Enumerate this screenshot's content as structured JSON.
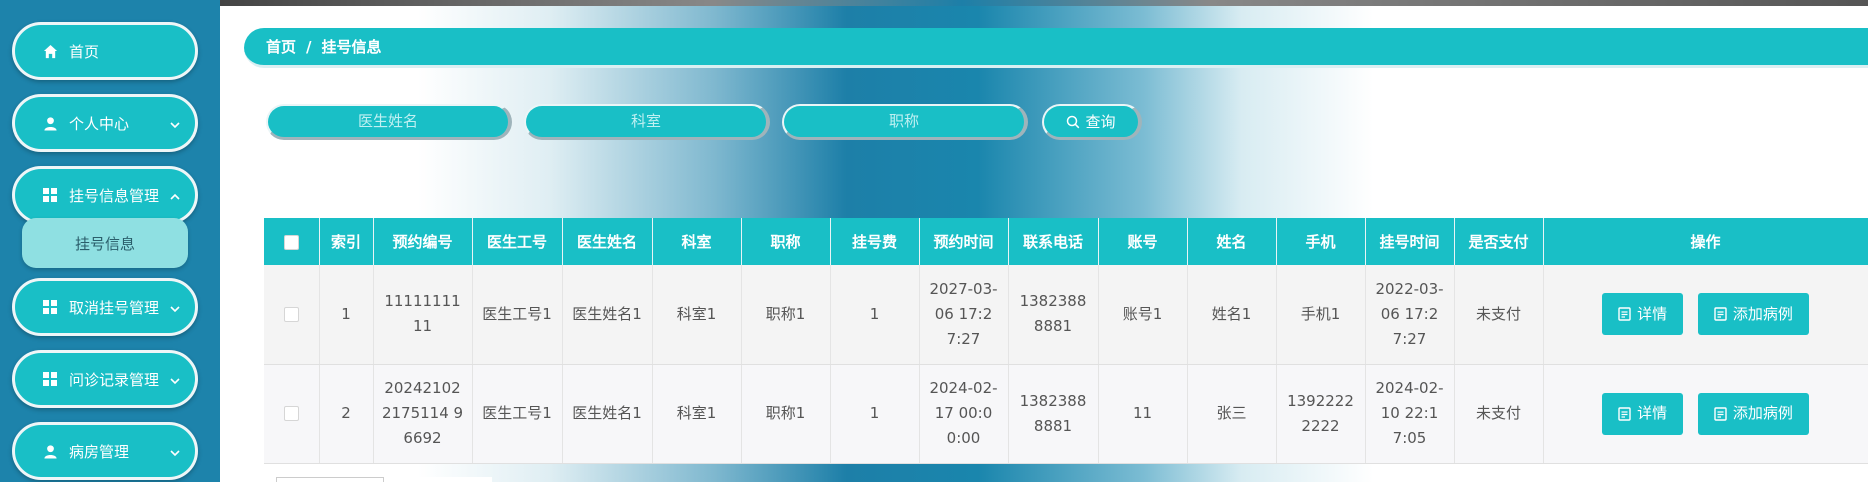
{
  "sidebar": {
    "items": [
      {
        "label": "首页",
        "icon": "home-icon"
      },
      {
        "label": "个人中心",
        "icon": "user-icon"
      },
      {
        "label": "挂号信息管理",
        "icon": "grid-icon"
      },
      {
        "label": "取消挂号管理",
        "icon": "grid-icon"
      },
      {
        "label": "问诊记录管理",
        "icon": "grid-icon"
      },
      {
        "label": "病房管理",
        "icon": "user-icon"
      }
    ],
    "submenu": {
      "label": "挂号信息"
    }
  },
  "breadcrumb": {
    "home": "首页",
    "separator": "/",
    "current": "挂号信息"
  },
  "search": {
    "doctor_name_placeholder": "医生姓名",
    "department_placeholder": "科室",
    "title_placeholder": "职称",
    "query_label": "查询"
  },
  "table": {
    "columns": [
      "索引",
      "预约编号",
      "医生工号",
      "医生姓名",
      "科室",
      "职称",
      "挂号费",
      "预约时间",
      "联系电话",
      "账号",
      "姓名",
      "手机",
      "挂号时间",
      "是否支付",
      "操作"
    ],
    "rows": [
      {
        "index": "1",
        "appt_no": "1111111111",
        "doctor_id": "医生工号1",
        "doctor_name": "医生姓名1",
        "department": "科室1",
        "title": "职称1",
        "fee": "1",
        "appt_time": "2027-03-06 17:27:27",
        "contact_phone": "13823888881",
        "account": "账号1",
        "name": "姓名1",
        "mobile": "手机1",
        "reg_time": "2022-03-06 17:27:27",
        "paid": "未支付"
      },
      {
        "index": "2",
        "appt_no": "202421022175114 96692",
        "doctor_id": "医生工号1",
        "doctor_name": "医生姓名1",
        "department": "科室1",
        "title": "职称1",
        "fee": "1",
        "appt_time": "2024-02-17 00:00:00",
        "contact_phone": "13823888881",
        "account": "11",
        "name": "张三",
        "mobile": "13922222222",
        "reg_time": "2024-02-10 22:17:05",
        "paid": "未支付"
      }
    ],
    "actions": {
      "detail": "详情",
      "add_record": "添加病例"
    }
  },
  "colors": {
    "accent": "#19bfc6",
    "sidebar": "#1d83ab",
    "submenu": "#8fe0e2"
  }
}
